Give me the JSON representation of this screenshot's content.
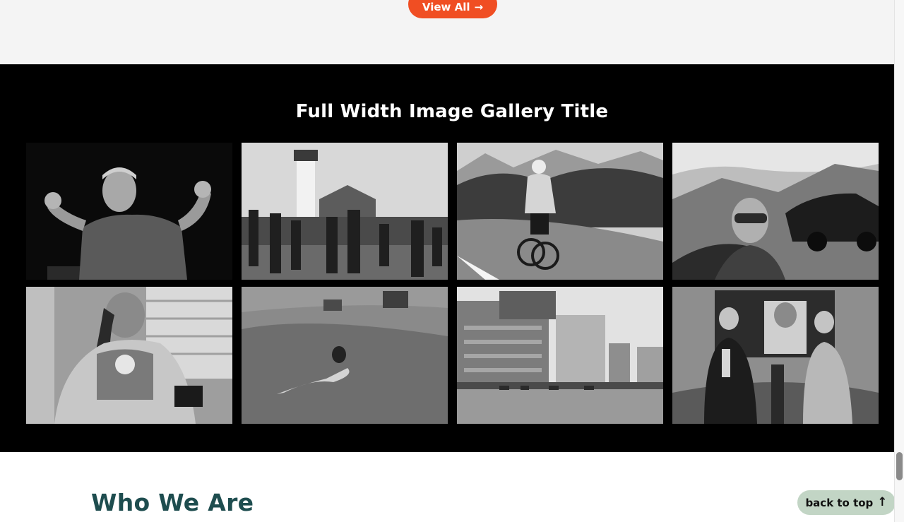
{
  "top": {
    "view_all_label": "View All",
    "view_all_icon": "arrow-right-icon",
    "accent_color": "#f04e23"
  },
  "gallery": {
    "title": "Full Width Image Gallery Title",
    "background": "#000000",
    "images": [
      {
        "id": "man-flexing",
        "scene": "flex"
      },
      {
        "id": "lighthouse-race",
        "scene": "lighthouse"
      },
      {
        "id": "mountain-cyclist",
        "scene": "cyclist"
      },
      {
        "id": "mountain-selfie",
        "scene": "selfie"
      },
      {
        "id": "woman-window",
        "scene": "window"
      },
      {
        "id": "field-painting",
        "scene": "field"
      },
      {
        "id": "modern-building",
        "scene": "building"
      },
      {
        "id": "conference-booth",
        "scene": "conference"
      }
    ]
  },
  "who": {
    "title": "Who We Are",
    "title_color": "#1e4d4f"
  },
  "back_to_top": {
    "label": "back to top",
    "icon": "arrow-up-icon",
    "background": "#c2d5c5"
  }
}
